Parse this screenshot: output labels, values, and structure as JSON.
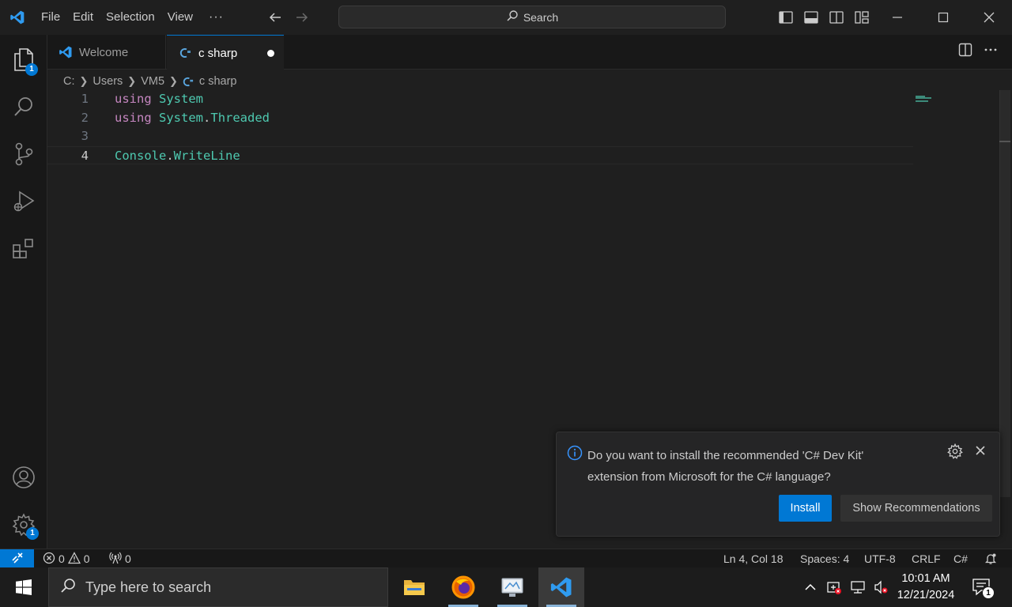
{
  "titlebar": {
    "menu": [
      "File",
      "Edit",
      "Selection",
      "View"
    ],
    "more": "···",
    "search_label": "Search"
  },
  "activity": {
    "explorer_badge": "1",
    "settings_badge": "1"
  },
  "tabs": [
    {
      "label": "Welcome",
      "active": false
    },
    {
      "label": "c sharp",
      "active": true,
      "dirty": true
    }
  ],
  "breadcrumb": [
    "C:",
    "Users",
    "VM5",
    "c sharp"
  ],
  "editor": {
    "lines": [
      {
        "no": "1",
        "tokens": [
          [
            "kw",
            "using"
          ],
          [
            "pl",
            " "
          ],
          [
            "ty",
            "System"
          ]
        ]
      },
      {
        "no": "2",
        "tokens": [
          [
            "kw",
            "using"
          ],
          [
            "pl",
            " "
          ],
          [
            "ty",
            "System"
          ],
          [
            "pl",
            "."
          ],
          [
            "ty",
            "Threaded"
          ]
        ]
      },
      {
        "no": "3",
        "tokens": []
      },
      {
        "no": "4",
        "tokens": [
          [
            "ty",
            "Console"
          ],
          [
            "pl",
            "."
          ],
          [
            "ty",
            "WriteLine"
          ]
        ]
      }
    ],
    "active_line": 4
  },
  "notification": {
    "line1": "Do you want to install the recommended 'C# Dev Kit'",
    "line2": "extension from Microsoft for the C# language?",
    "install_label": "Install",
    "recommend_label": "Show Recommendations"
  },
  "statusbar": {
    "errors": "0",
    "warnings": "0",
    "ports": "0",
    "position": "Ln 4, Col 18",
    "spaces": "Spaces: 4",
    "encoding": "UTF-8",
    "eol": "CRLF",
    "language": "C#"
  },
  "taskbar": {
    "search_placeholder": "Type here to search",
    "time": "10:01 AM",
    "date": "12/21/2024",
    "notification_count": "1"
  },
  "colors": {
    "accent": "#0078d4",
    "keyword": "#c586c0",
    "type": "#4ec9b0"
  }
}
